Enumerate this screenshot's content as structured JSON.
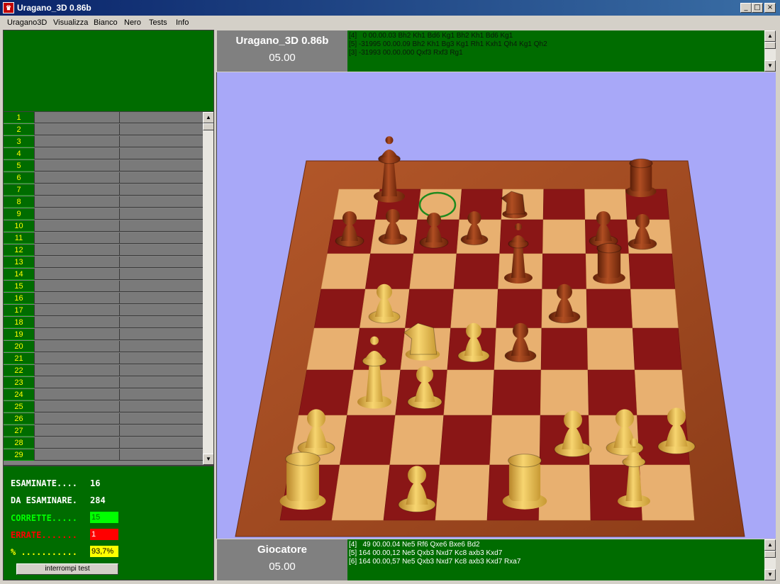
{
  "window": {
    "title": "Uragano_3D 0.86b"
  },
  "menu": [
    "Uragano3D",
    "Visualizza",
    "Bianco",
    "Nero",
    "Tests",
    "Info"
  ],
  "move_rows": [
    "1",
    "2",
    "3",
    "4",
    "5",
    "6",
    "7",
    "8",
    "9",
    "10",
    "11",
    "12",
    "13",
    "14",
    "15",
    "16",
    "17",
    "18",
    "19",
    "20",
    "21",
    "22",
    "23",
    "24",
    "25",
    "26",
    "27",
    "28",
    "29"
  ],
  "stats": {
    "examined_label": "ESAMINATE....",
    "examined_value": "16",
    "remaining_label": "DA ESAMINARE.",
    "remaining_value": "284",
    "correct_label": "CORRETTE.....",
    "correct_value": "15",
    "wrong_label": "ERRATE.......",
    "wrong_value": "1",
    "percent_label": "% ...........",
    "percent_value": "93,7%",
    "stop_button": "interrompi test"
  },
  "engine_top": {
    "name": "Uragano_3D 0.86b",
    "time": "05.00",
    "lines": [
      "[4]   0 00.00.03 Bh2 Kh1 Bd6 Kg1 Bh2 Kh1 Bd6 Kg1",
      "[5] -31995 00.00.09 Bh2 Kh1 Bg3 Kg1 Rh1 Kxh1 Qh4 Kg1 Qh2",
      "[3] -31993 00.00.000 Qxf3 Rxf3 Rg1"
    ]
  },
  "engine_bottom": {
    "name": "Giocatore",
    "time": "05.00",
    "lines": [
      "[4]   49 00.00.04 Ne5 Rf6 Qxe6 Bxe6 Bd2",
      "[5] 164 00.00,12 Ne5 Qxb3 Nxd7 Kc8 axb3 Kxd7",
      "[6] 164 00.00,57 Ne5 Qxb3 Nxd7 Kc8 axb3 Kxd7 Rxa7"
    ]
  },
  "colors": {
    "panel_green": "#006c00",
    "sky": "#a8a8f8",
    "dark_square": "#8a1616",
    "light_square": "#e8b070",
    "frame": "#a04a1e",
    "white_piece": "#f0c050",
    "black_piece": "#8a3412",
    "correct_box": "#00ff00",
    "wrong_box": "#ff0000",
    "percent_box": "#ffff00"
  }
}
